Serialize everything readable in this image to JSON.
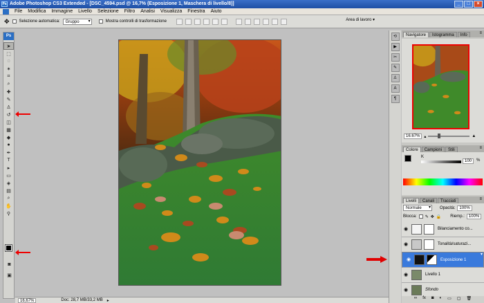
{
  "titlebar": {
    "title": "Adobe Photoshop CS3 Extended - [DSC_4594.psd @ 16,7% (Esposizione 1, Maschera di livello/8)]"
  },
  "menu": [
    "File",
    "Modifica",
    "Immagine",
    "Livello",
    "Selezione",
    "Filtro",
    "Analisi",
    "Visualizza",
    "Finestra",
    "Aiuto"
  ],
  "options": {
    "auto_select_label": "Selezione automatica:",
    "auto_select_value": "Gruppo",
    "transform_label": "Mostra controlli di trasformazione",
    "workspace_label": "Area di lavoro ▾"
  },
  "toolbox": {
    "logo": "Ps"
  },
  "status": {
    "zoom": "16,67%",
    "doc": "Doc: 28,7 MB/33,2 MB"
  },
  "navigator": {
    "tabs": [
      "Navigatore",
      "Istogramma",
      "Info"
    ],
    "zoom": "16.67%"
  },
  "color": {
    "tabs": [
      "Colore",
      "Campioni",
      "Stili"
    ],
    "channel": "K",
    "value": "100",
    "unit": "%"
  },
  "layers": {
    "tabs": [
      "Livelli",
      "Canali",
      "Tracciati"
    ],
    "blend_mode": "Normale",
    "opacity_label": "Opacità:",
    "opacity": "100%",
    "lock_label": "Blocca:",
    "fill_label": "Riemp.:",
    "fill": "100%",
    "items": [
      {
        "name": "Bilanciamento co..."
      },
      {
        "name": "Tonalità/saturazi..."
      },
      {
        "name": "Esposizione 1"
      },
      {
        "name": "Livello 1"
      },
      {
        "name": "Sfondo"
      }
    ],
    "selected_index": 2
  },
  "colors": {
    "accent": "#3a7adc",
    "annotation": "#e00000"
  }
}
